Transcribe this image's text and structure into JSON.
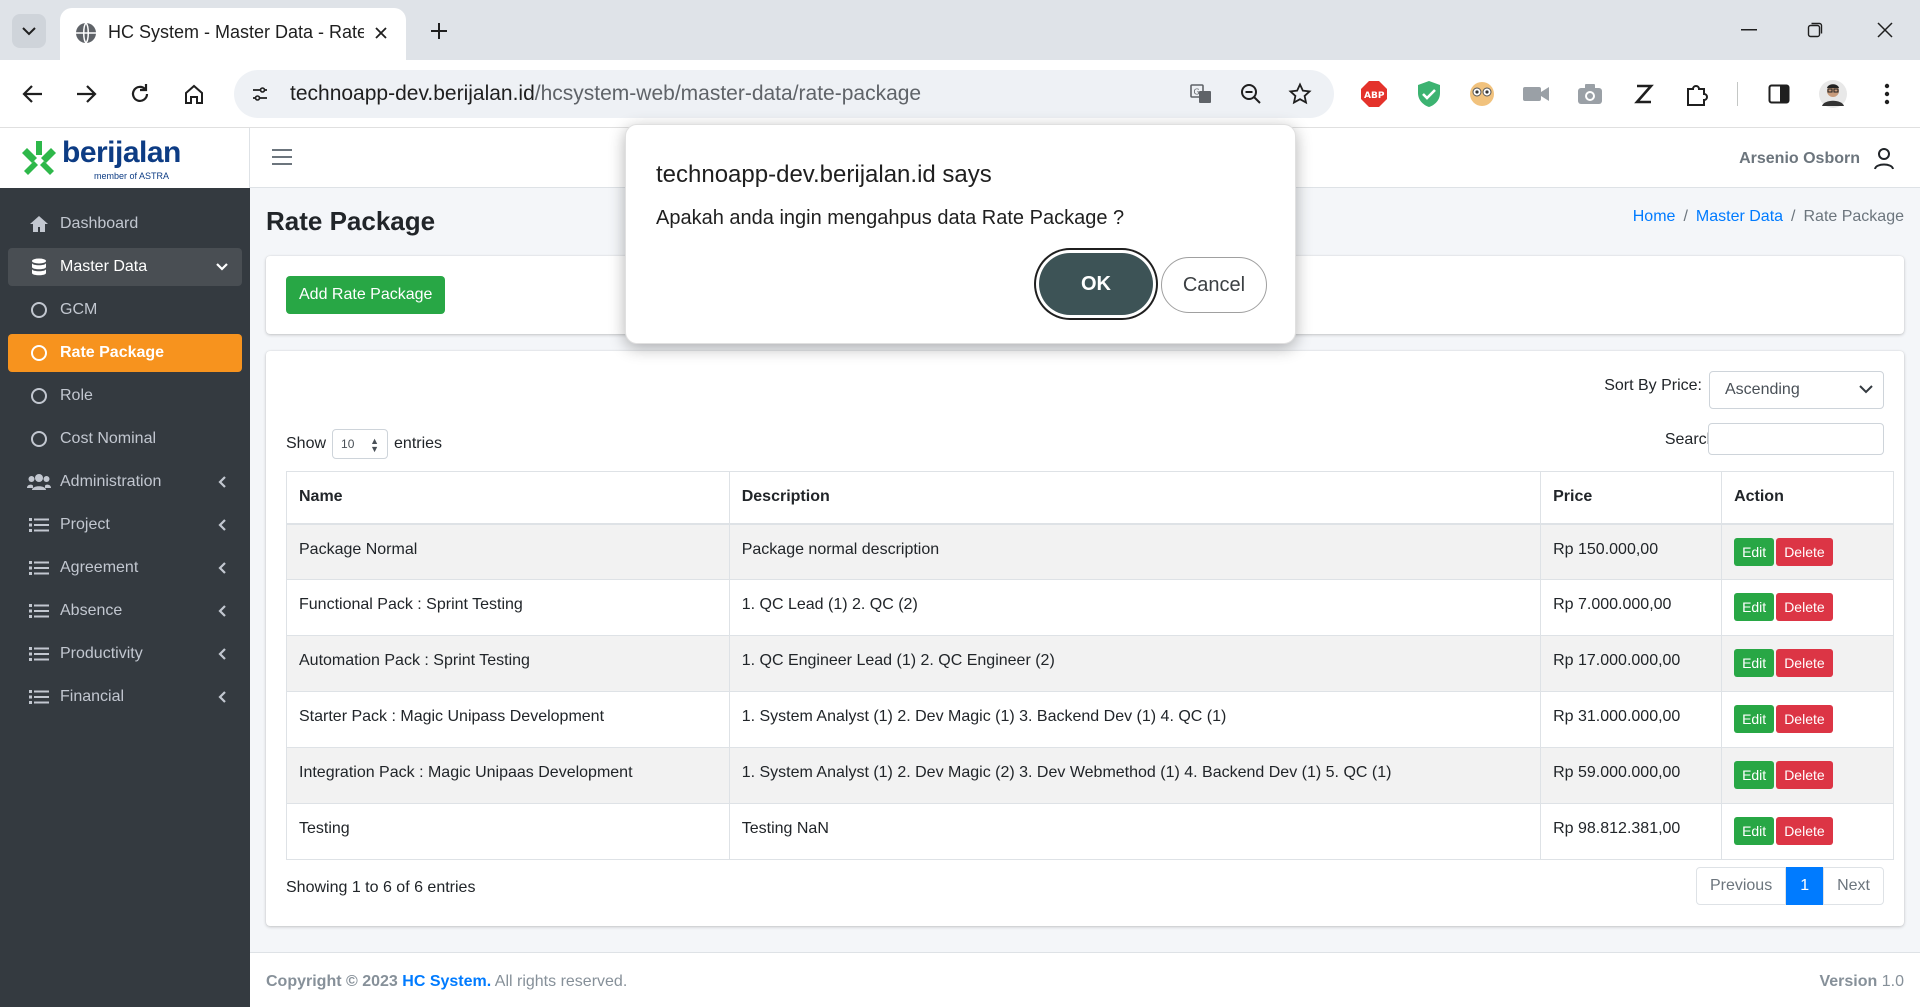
{
  "browser": {
    "tab_title": "HC System - Master Data - Rate Package",
    "url_host": "technoapp-dev.berijalan.id",
    "url_path": "/hcsystem-web/master-data/rate-package",
    "extensions": [
      "adblock-icon",
      "shield-icon",
      "eyes-icon",
      "video-icon",
      "camera-icon",
      "z-icon",
      "puzzle-icon"
    ],
    "extension_colors": {
      "adblock": "#e4322b",
      "shield": "#3cb371"
    }
  },
  "brand": {
    "name": "berijalan",
    "sub": "member of ASTRA",
    "color": "#0d3c84",
    "mark_color": "#2eb84a"
  },
  "sidebar": {
    "items": [
      {
        "label": "Dashboard",
        "icon": "home-icon"
      },
      {
        "label": "Master Data",
        "icon": "database-icon"
      },
      {
        "label": "GCM",
        "icon": "circle-icon"
      },
      {
        "label": "Rate Package",
        "icon": "circle-icon"
      },
      {
        "label": "Role",
        "icon": "circle-icon"
      },
      {
        "label": "Cost Nominal",
        "icon": "circle-icon"
      },
      {
        "label": "Administration",
        "icon": "users-icon"
      },
      {
        "label": "Project",
        "icon": "list-icon"
      },
      {
        "label": "Agreement",
        "icon": "list-icon"
      },
      {
        "label": "Absence",
        "icon": "list-icon"
      },
      {
        "label": "Productivity",
        "icon": "list-icon"
      },
      {
        "label": "Financial",
        "icon": "list-icon"
      }
    ],
    "active_color": "#f7931e"
  },
  "header": {
    "user_name": "Arsenio Osborn"
  },
  "page": {
    "title": "Rate Package",
    "breadcrumb": [
      "Home",
      "Master Data",
      "Rate Package"
    ],
    "add_button": "Add Rate Package",
    "sort_label": "Sort By Price:",
    "sort_value": "Ascending",
    "show_label": "Show",
    "show_value": "10",
    "entries_label": "entries",
    "search_label": "Search:"
  },
  "table": {
    "columns": [
      "Name",
      "Description",
      "Price",
      "Action"
    ],
    "rows": [
      {
        "name": "Package Normal",
        "description": "Package normal description",
        "price": "Rp 150.000,00"
      },
      {
        "name": "Functional Pack : Sprint Testing",
        "description": "1. QC Lead (1) 2. QC (2)",
        "price": "Rp 7.000.000,00"
      },
      {
        "name": "Automation Pack : Sprint Testing",
        "description": "1. QC Engineer Lead (1) 2. QC Engineer (2)",
        "price": "Rp 17.000.000,00"
      },
      {
        "name": "Starter Pack : Magic Unipass Development",
        "description": "1. System Analyst (1) 2. Dev Magic (1) 3. Backend Dev (1) 4. QC (1)",
        "price": "Rp 31.000.000,00"
      },
      {
        "name": "Integration Pack : Magic Unipaas Development",
        "description": "1. System Analyst (1) 2. Dev Magic (2) 3. Dev Webmethod (1) 4. Backend Dev (1) 5. QC (1)",
        "price": "Rp 59.000.000,00"
      },
      {
        "name": "Testing",
        "description": "Testing NaN",
        "price": "Rp 98.812.381,00"
      }
    ],
    "edit_label": "Edit",
    "delete_label": "Delete",
    "info": "Showing 1 to 6 of 6 entries",
    "pager": {
      "prev": "Previous",
      "current": "1",
      "next": "Next"
    }
  },
  "footer": {
    "copyright_prefix": "Copyright © 2023",
    "brand": "HC System.",
    "rights": "All rights reserved.",
    "version_label": "Version",
    "version": "1.0"
  },
  "dialog": {
    "title": "technoapp-dev.berijalan.id says",
    "message": "Apakah anda ingin mengahpus data Rate Package ?",
    "ok": "OK",
    "cancel": "Cancel"
  }
}
